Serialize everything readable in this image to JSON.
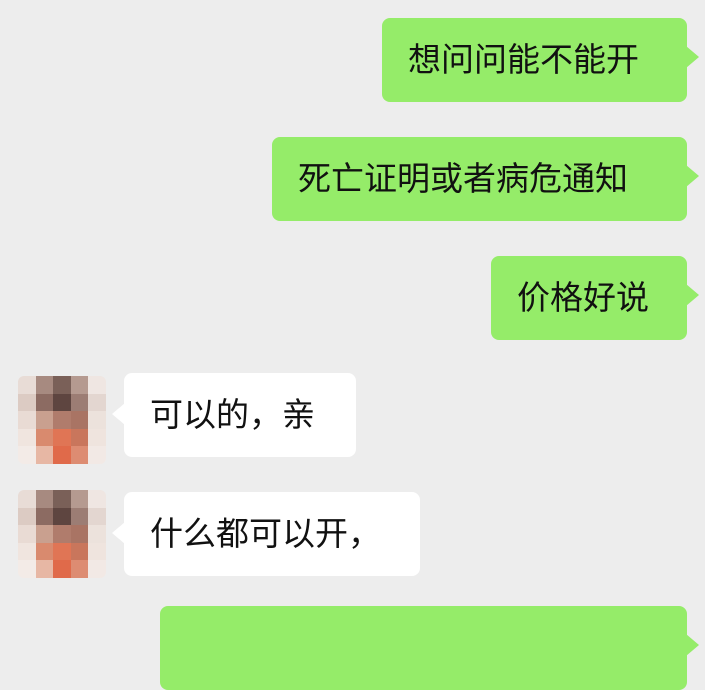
{
  "messages": [
    {
      "direction": "outgoing",
      "text": "想问问能不能开"
    },
    {
      "direction": "outgoing",
      "text": "死亡证明或者病危通知"
    },
    {
      "direction": "outgoing",
      "text": "价格好说"
    },
    {
      "direction": "incoming",
      "text": "可以的，亲"
    },
    {
      "direction": "incoming",
      "text": "什么都可以开，"
    }
  ],
  "colors": {
    "background": "#ededed",
    "outgoing_bubble": "#95ec69",
    "incoming_bubble": "#ffffff",
    "text": "#111111"
  },
  "avatar_pixels": [
    "#e8dcd6",
    "#a78a80",
    "#7a6058",
    "#b59a90",
    "#efe6e2",
    "#dccbc3",
    "#8c6b62",
    "#5e4540",
    "#9c7d74",
    "#e3d6d0",
    "#e9dbd4",
    "#c9a08f",
    "#b07c6c",
    "#a97464",
    "#ece2dc",
    "#f0e5df",
    "#d98a6e",
    "#e07555",
    "#c9765c",
    "#efe4de",
    "#f3ebe7",
    "#e7b7a4",
    "#e06a4a",
    "#dd8c72",
    "#f2e9e5"
  ]
}
